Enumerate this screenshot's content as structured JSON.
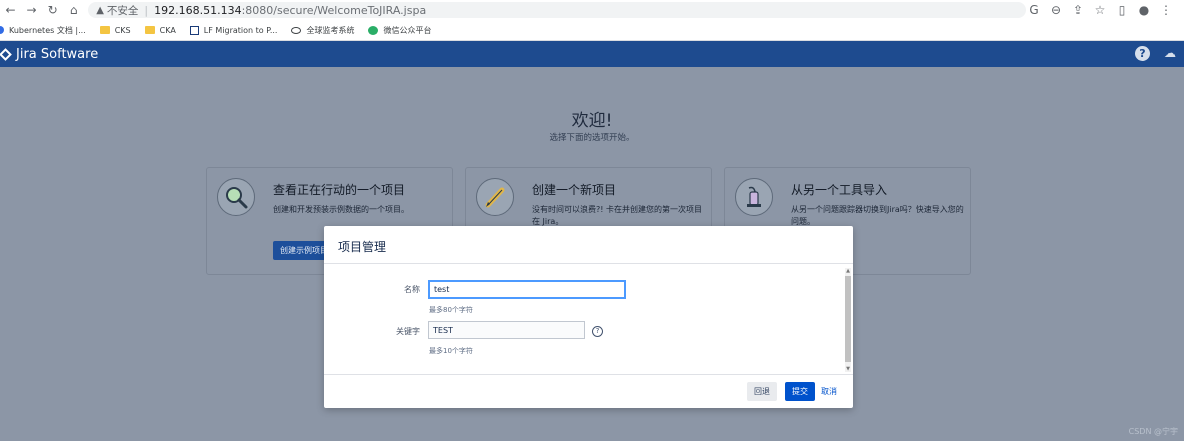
{
  "browser": {
    "insecure_label": "不安全",
    "url_host": "192.168.51.134",
    "url_path": ":8080/secure/WelcomeToJIRA.jspa",
    "bookmarks": [
      {
        "label": "Kubernetes 文档 |...",
        "icon": "kubernetes-icon"
      },
      {
        "label": "CKS",
        "icon": "folder-icon"
      },
      {
        "label": "CKA",
        "icon": "folder-icon"
      },
      {
        "label": "LF Migration to P...",
        "icon": "lf-icon"
      },
      {
        "label": "全球监考系统",
        "icon": "eye-icon"
      },
      {
        "label": "微信公众平台",
        "icon": "wechat-icon"
      }
    ]
  },
  "jira": {
    "logo_text": "Jira Software"
  },
  "welcome": {
    "title": "欢迎!",
    "subtitle": "选择下面的选项开始。"
  },
  "cards": [
    {
      "title": "查看正在行动的一个项目",
      "desc": "创建和开发预装示例数据的一个项目。",
      "button": "创建示例项目",
      "icon": "magnifier-icon"
    },
    {
      "title": "创建一个新项目",
      "desc": "没有时间可以浪费?! 卡在并创建您的第一次项目在 Jira。",
      "icon": "pencil-icon"
    },
    {
      "title": "从另一个工具导入",
      "desc": "从另一个问题跟踪器切换到Jira吗？快速导入您的问题。",
      "icon": "vacuum-icon"
    }
  ],
  "modal": {
    "title": "项目管理",
    "name_label": "名称",
    "name_value": "test",
    "name_hint": "最多80个字符",
    "key_label": "关键字",
    "key_value": "TEST",
    "key_hint": "最多10个字符",
    "back_label": "回退",
    "submit_label": "提交",
    "cancel_label": "取消"
  },
  "watermark": "CSDN @宁宇"
}
